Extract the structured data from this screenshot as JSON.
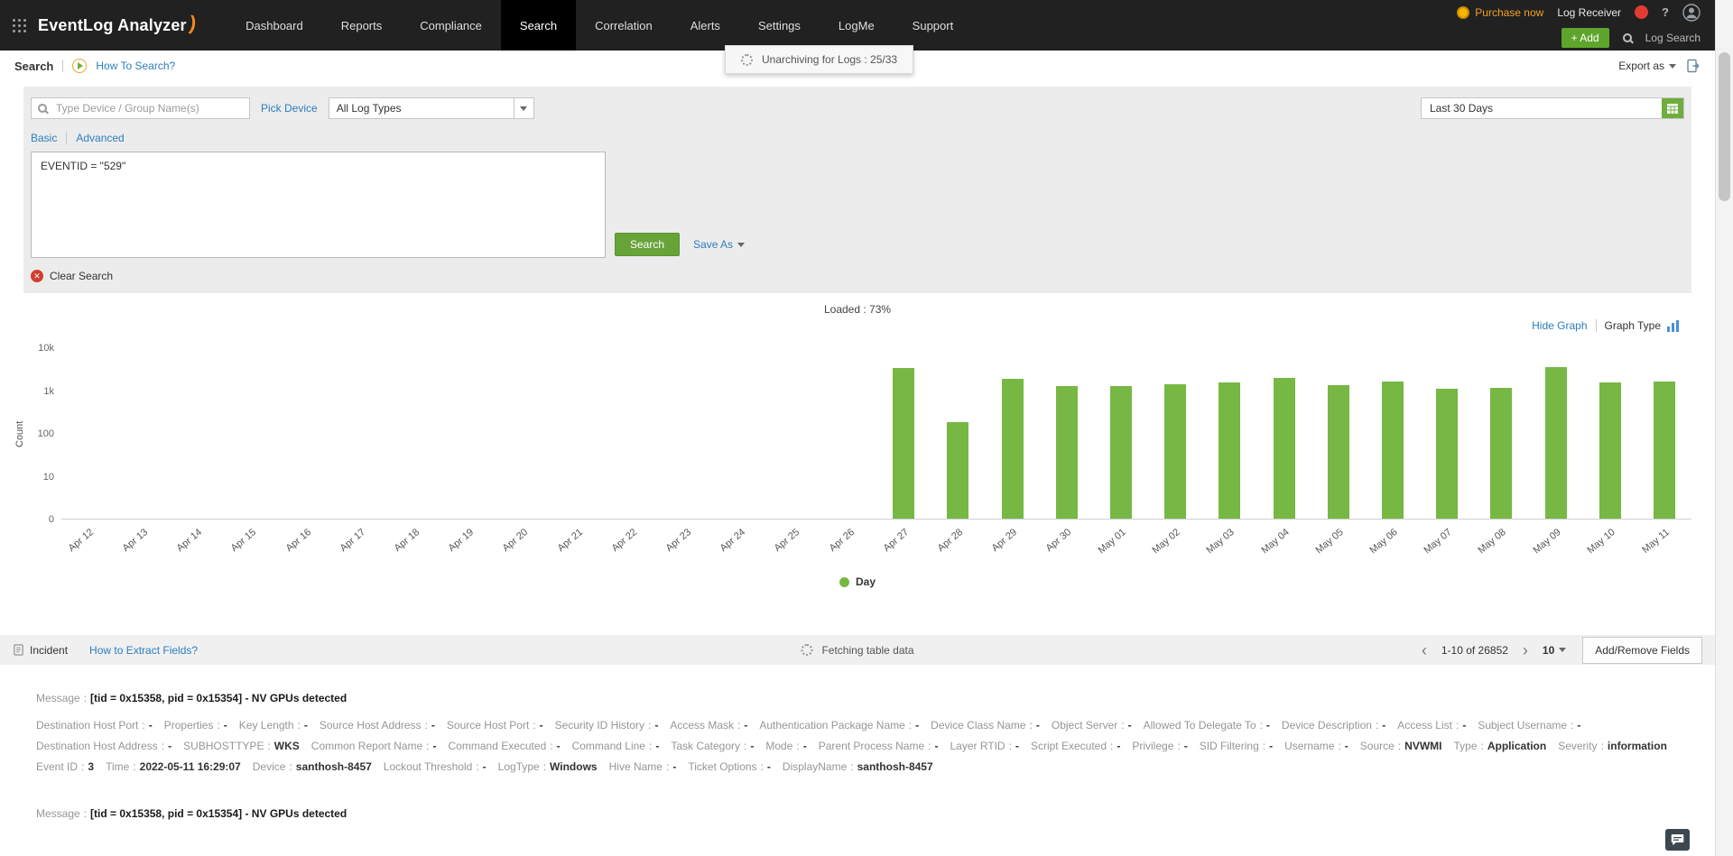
{
  "navbar": {
    "brand": "EventLog Analyzer",
    "items": [
      "Dashboard",
      "Reports",
      "Compliance",
      "Search",
      "Correlation",
      "Alerts",
      "Settings",
      "LogMe",
      "Support"
    ],
    "active_item": "Search",
    "purchase_now": "Purchase now",
    "log_receiver": "Log Receiver",
    "help": "?",
    "add_button": "+ Add",
    "log_search": "Log Search"
  },
  "subheader": {
    "title": "Search",
    "how_to": "How To Search?",
    "export_as": "Export as",
    "toast": "Unarchiving for Logs : 25/33"
  },
  "search_form": {
    "device_placeholder": "Type Device / Group Name(s)",
    "pick_device": "Pick Device",
    "log_type": "All Log Types",
    "date_range": "Last 30 Days",
    "tab_basic": "Basic",
    "tab_advanced": "Advanced",
    "query": "EVENTID = \"529\"",
    "search_button": "Search",
    "save_as": "Save As",
    "clear_search": "Clear Search"
  },
  "status": {
    "loaded": "Loaded : 73%"
  },
  "chart_controls": {
    "hide_graph": "Hide Graph",
    "graph_type": "Graph Type"
  },
  "chart_data": {
    "type": "bar",
    "title": "",
    "xlabel": "Day",
    "ylabel": "Count",
    "scale": "log",
    "y_ticks": [
      "10k",
      "1k",
      "100",
      "10",
      "0"
    ],
    "bar_color": "#76b843",
    "legend": [
      {
        "label": "Day",
        "color": "#76b843"
      }
    ],
    "categories": [
      "Apr 12",
      "Apr 13",
      "Apr 14",
      "Apr 15",
      "Apr 16",
      "Apr 17",
      "Apr 18",
      "Apr 19",
      "Apr 20",
      "Apr 21",
      "Apr 22",
      "Apr 23",
      "Apr 24",
      "Apr 25",
      "Apr 26",
      "Apr 27",
      "Apr 28",
      "Apr 29",
      "Apr 30",
      "May 01",
      "May 02",
      "May 03",
      "May 04",
      "May 05",
      "May 06",
      "May 07",
      "May 08",
      "May 09",
      "May 10",
      "May 11"
    ],
    "values": [
      0,
      0,
      0,
      0,
      0,
      0,
      0,
      0,
      0,
      0,
      0,
      0,
      0,
      0,
      0,
      3300,
      180,
      1800,
      1250,
      1250,
      1400,
      1500,
      1900,
      1300,
      1600,
      1100,
      1150,
      3500,
      1500,
      1550
    ]
  },
  "table_toolbar": {
    "incident": "Incident",
    "how_to_extract": "How to Extract Fields?",
    "fetching": "Fetching table data",
    "pagination": "1-10 of 26852",
    "page_size": "10",
    "add_remove_fields": "Add/Remove Fields"
  },
  "records": [
    {
      "message_label": "Message",
      "message_value": "[tid = 0x15358, pid = 0x15354] - NV GPUs detected",
      "rows": [
        [
          {
            "label": "Destination Host Port",
            "value": "-"
          },
          {
            "label": "Properties",
            "value": "-"
          },
          {
            "label": "Key Length",
            "value": "-"
          },
          {
            "label": "Source Host Address",
            "value": "-"
          },
          {
            "label": "Source Host Port",
            "value": "-"
          },
          {
            "label": "Security ID History",
            "value": "-"
          },
          {
            "label": "Access Mask",
            "value": "-"
          },
          {
            "label": "Authentication Package Name",
            "value": "-"
          },
          {
            "label": "Device Class Name",
            "value": "-"
          },
          {
            "label": "Object Server",
            "value": "-"
          },
          {
            "label": "Allowed To Delegate To",
            "value": "-"
          },
          {
            "label": "Device Description",
            "value": "-"
          },
          {
            "label": "Access List",
            "value": "-"
          },
          {
            "label": "Subject Username",
            "value": "-"
          }
        ],
        [
          {
            "label": "Destination Host Address",
            "value": "-"
          },
          {
            "label": "SUBHOSTTYPE",
            "value": "WKS"
          },
          {
            "label": "Common Report Name",
            "value": "-"
          },
          {
            "label": "Command Executed",
            "value": "-"
          },
          {
            "label": "Command Line",
            "value": "-"
          },
          {
            "label": "Task Category",
            "value": "-"
          },
          {
            "label": "Mode",
            "value": "-"
          },
          {
            "label": "Parent Process Name",
            "value": "-"
          },
          {
            "label": "Layer RTID",
            "value": "-"
          },
          {
            "label": "Script Executed",
            "value": "-"
          },
          {
            "label": "Privilege",
            "value": "-"
          },
          {
            "label": "SID Filtering",
            "value": "-"
          },
          {
            "label": "Username",
            "value": "-"
          },
          {
            "label": "Source",
            "value": "NVWMI"
          },
          {
            "label": "Type",
            "value": "Application"
          },
          {
            "label": "Severity",
            "value": "information"
          }
        ],
        [
          {
            "label": "Event ID",
            "value": "3"
          },
          {
            "label": "Time",
            "value": "2022-05-11 16:29:07"
          },
          {
            "label": "Device",
            "value": "santhosh-8457"
          },
          {
            "label": "Lockout Threshold",
            "value": "-"
          },
          {
            "label": "LogType",
            "value": "Windows"
          },
          {
            "label": "Hive Name",
            "value": "-"
          },
          {
            "label": "Ticket Options",
            "value": "-"
          },
          {
            "label": "DisplayName",
            "value": "santhosh-8457"
          }
        ]
      ]
    },
    {
      "message_label": "Message",
      "message_value": "[tid = 0x15358, pid = 0x15354] - NV GPUs detected",
      "rows": []
    }
  ]
}
